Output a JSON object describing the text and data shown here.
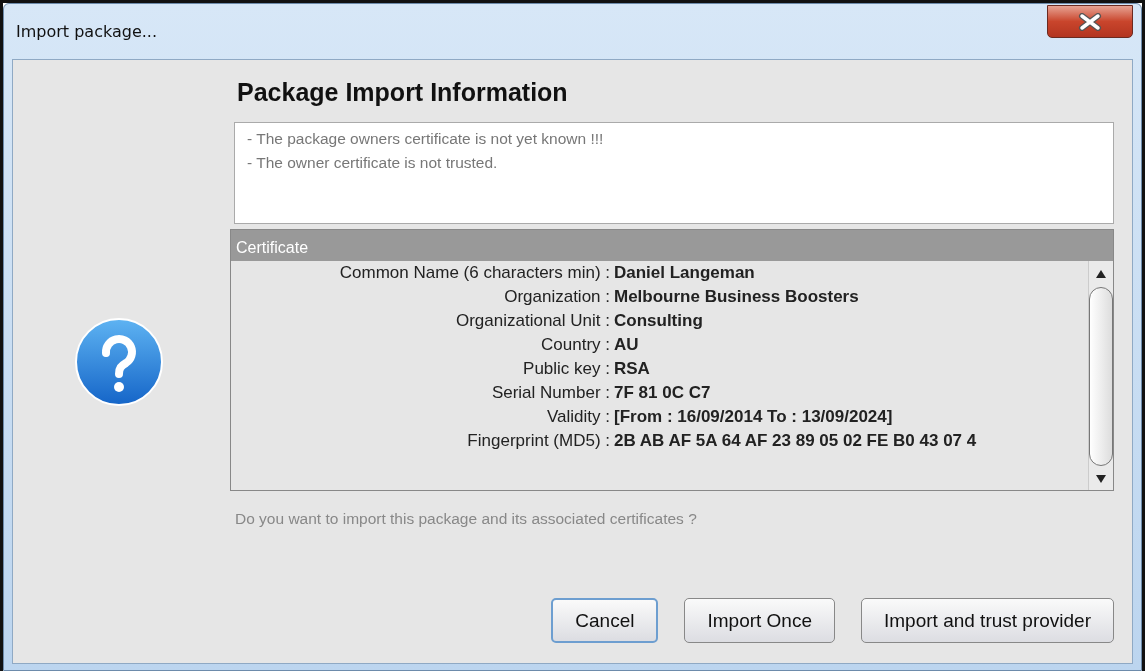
{
  "window": {
    "title": "Import package..."
  },
  "heading": "Package Import Information",
  "messages": [
    "- The package owners certificate is not yet known !!!",
    "- The owner certificate is not trusted."
  ],
  "certificate": {
    "title": "Certificate",
    "fields": [
      {
        "label": "Common Name (6 characters min) :",
        "value": "Daniel Langeman"
      },
      {
        "label": "Organization :",
        "value": "Melbourne Business Boosters"
      },
      {
        "label": "Organizational Unit :",
        "value": "Consulting"
      },
      {
        "label": "Country :",
        "value": "AU"
      },
      {
        "label": "Public key :",
        "value": "RSA"
      },
      {
        "label": "Serial Number :",
        "value": "7F 81 0C C7"
      },
      {
        "label": "Validity :",
        "value": "[From : 16/09/2014 To : 13/09/2024]"
      },
      {
        "label": "Fingerprint (MD5) :",
        "value": "2B AB AF 5A 64 AF 23 89 05 02 FE B0 43 07 4"
      }
    ]
  },
  "question": "Do you want to import this package and its associated certificates ?",
  "buttons": [
    {
      "label": "Cancel",
      "focused": true
    },
    {
      "label": "Import Once",
      "focused": false
    },
    {
      "label": "Import and trust provider",
      "focused": false
    }
  ]
}
